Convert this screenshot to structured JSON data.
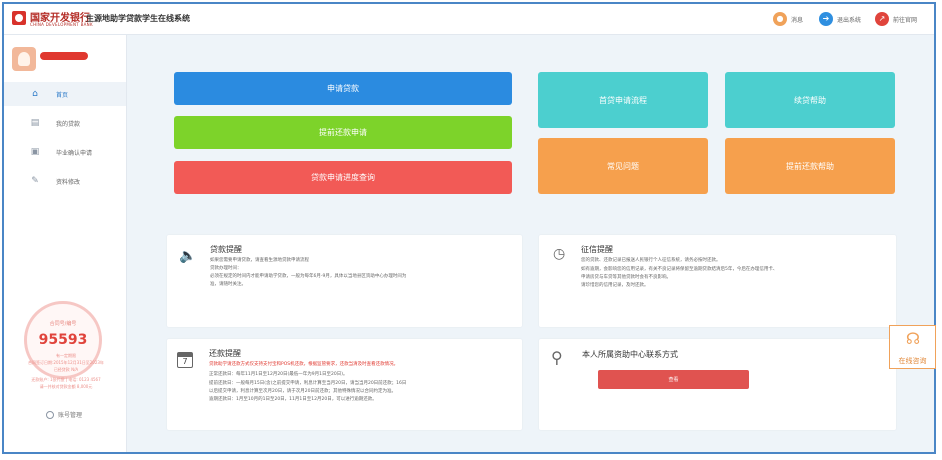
{
  "header": {
    "bank_name": "国家开发银行",
    "bank_name_en": "CHINA DEVELOPMENT BANK",
    "system_title": "生源地助学贷款学生在线系统",
    "actions": [
      {
        "label": "消息",
        "icon": "bell-icon",
        "color": "#f0a25a"
      },
      {
        "label": "退出系统",
        "icon": "logout-icon",
        "color": "#2f8fe0"
      },
      {
        "label": "前往官网",
        "icon": "external-link-icon",
        "color": "#e0443c"
      }
    ]
  },
  "sidebar": {
    "items": [
      {
        "label": "首页",
        "icon": "home-icon",
        "active": true
      },
      {
        "label": "我的贷款",
        "icon": "document-icon",
        "active": false
      },
      {
        "label": "毕业确认申请",
        "icon": "graduation-icon",
        "active": false
      },
      {
        "label": "资料修改",
        "icon": "edit-icon",
        "active": false
      }
    ],
    "contract": {
      "label": "合同号/编号",
      "number": "95593",
      "notes": [
        "有一定期限",
        "合同签订日期:2015年12月31日至2023年",
        "已经贷款 N/A",
        "还款账户: 1张代偿 | 电话: 0123 4567",
        "请一并核对贷款金额 8,000元"
      ]
    },
    "account_manage": "账号管理"
  },
  "main_buttons": {
    "apply_loan": {
      "label": "申请贷款",
      "color": "#2b8be0"
    },
    "prepay_apply": {
      "label": "提前还款申请",
      "color": "#7dd32a"
    },
    "progress_query": {
      "label": "贷款申请进度查询",
      "color": "#f25a56"
    },
    "first_loan_process": {
      "label": "首贷申请流程",
      "color": "#4ccfcf"
    },
    "renew_help": {
      "label": "续贷帮助",
      "color": "#4ccfcf"
    },
    "faq": {
      "label": "常见问题",
      "color": "#f6a04d"
    },
    "prepay_help": {
      "label": "提前还款帮助",
      "color": "#f6a04d"
    }
  },
  "cards": {
    "loan_notice": {
      "title": "贷款提醒",
      "icon": "speaker-icon",
      "lines": [
        "如果您需要申请贷款，请查看生源地贷款申请流程",
        "贷款办理时间：",
        "必须在规定的时间内才能申请助学贷款，一般为每年6月-9月，具体以当地县区资助中心办理时间为",
        "准，请随时关注。"
      ]
    },
    "credit_notice": {
      "title": "征信提醒",
      "icon": "alarm-clock-icon",
      "lines": [
        "您的贷款、还款记录已报送人民银行个人征信系统，请务必按时还款。",
        "如有逾期，会影响您的信用记录，有关不良记录将保留至逾期贷款结清后5年，今后在办理信用卡、",
        "申请房贷与车贷等其他贷款时会有不良影响。",
        "请珍惜您的信用记录，及时还款。"
      ]
    },
    "repay_notice": {
      "title": "还款提醒",
      "icon": "calendar-icon",
      "calendar_day": "7",
      "lines": [
        {
          "text": "贷款助学请还款方式仅支持支付宝和POS机还款，根据监管要求，还款当清及时查看还款情况。",
          "red": true
        },
        {
          "text": "正常还款日：每年11月1日至12月20日(最低一年为9月1日至20日)。",
          "red": false
        },
        {
          "text": "提前还款日：一般每月15日(含)之前提交申请，利息计算至当月20日，请当当月20日前还款；16日",
          "red": false
        },
        {
          "text": "以后提交申请，利息计算至次月20日，请于次月20日前还款；其他特殊情况以合同约定为准。",
          "red": false
        },
        {
          "text": "逾期还款日：1月至10月的1日至20日，11月1日至12月20日，可以进行逾期还款。",
          "red": false
        }
      ]
    },
    "contact": {
      "title": "本人所属资助中心联系方式",
      "icon": "search-icon",
      "button_label": "查看"
    }
  },
  "online_service": {
    "label": "在线咨询",
    "icon": "headset-icon"
  }
}
